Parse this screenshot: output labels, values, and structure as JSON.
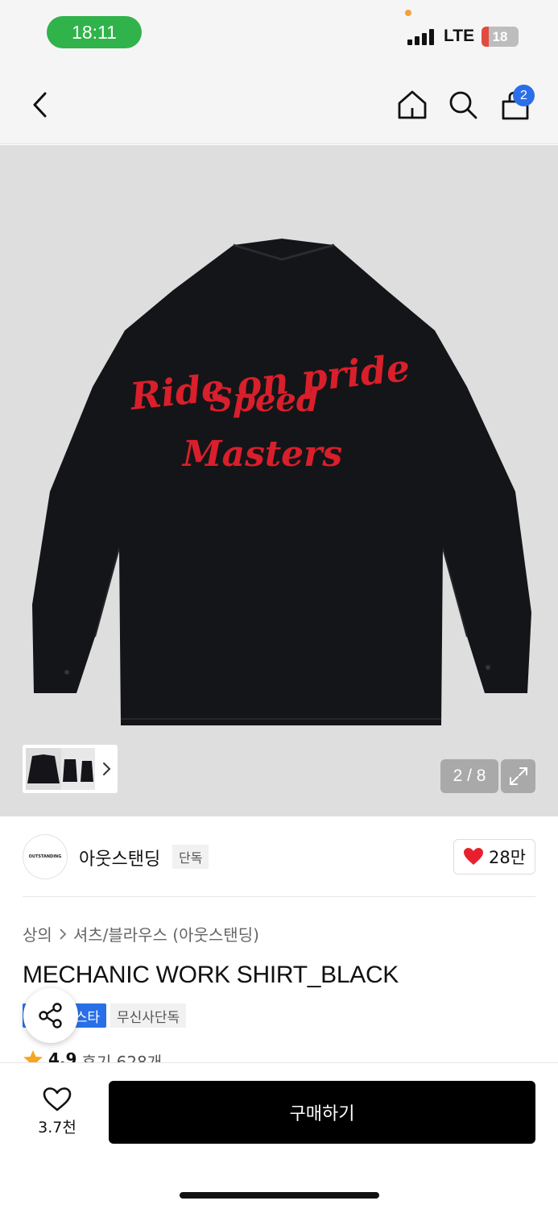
{
  "status_bar": {
    "time": "18:11",
    "network": "LTE",
    "battery": "18"
  },
  "nav": {
    "cart_count": "2"
  },
  "product_image": {
    "embroidery_line1": "Ride on pride",
    "embroidery_line2": "Speed",
    "embroidery_line3": "Masters",
    "counter": "2 / 8"
  },
  "brand": {
    "logo_text": "OUTSTANDING",
    "name": "아웃스탠딩",
    "exclusive_tag": "단독",
    "like_count": "28만"
  },
  "breadcrumb": {
    "category": "상의",
    "subcategory": "셔츠/블라우스 (아웃스탠딩)"
  },
  "product": {
    "title": "MECHANIC WORK SHIRT_BLACK",
    "tag_blue": "스타",
    "tag_grey": "무신사단독",
    "rating": "4.9",
    "reviews": "후기 628개"
  },
  "bottom": {
    "wish_count": "3.7천",
    "buy_label": "구매하기"
  },
  "colors": {
    "accent_blue": "#2a6fe8",
    "status_green": "#2fb34a",
    "heart_red": "#e8202e",
    "embroidery_red": "#d91f2b"
  }
}
